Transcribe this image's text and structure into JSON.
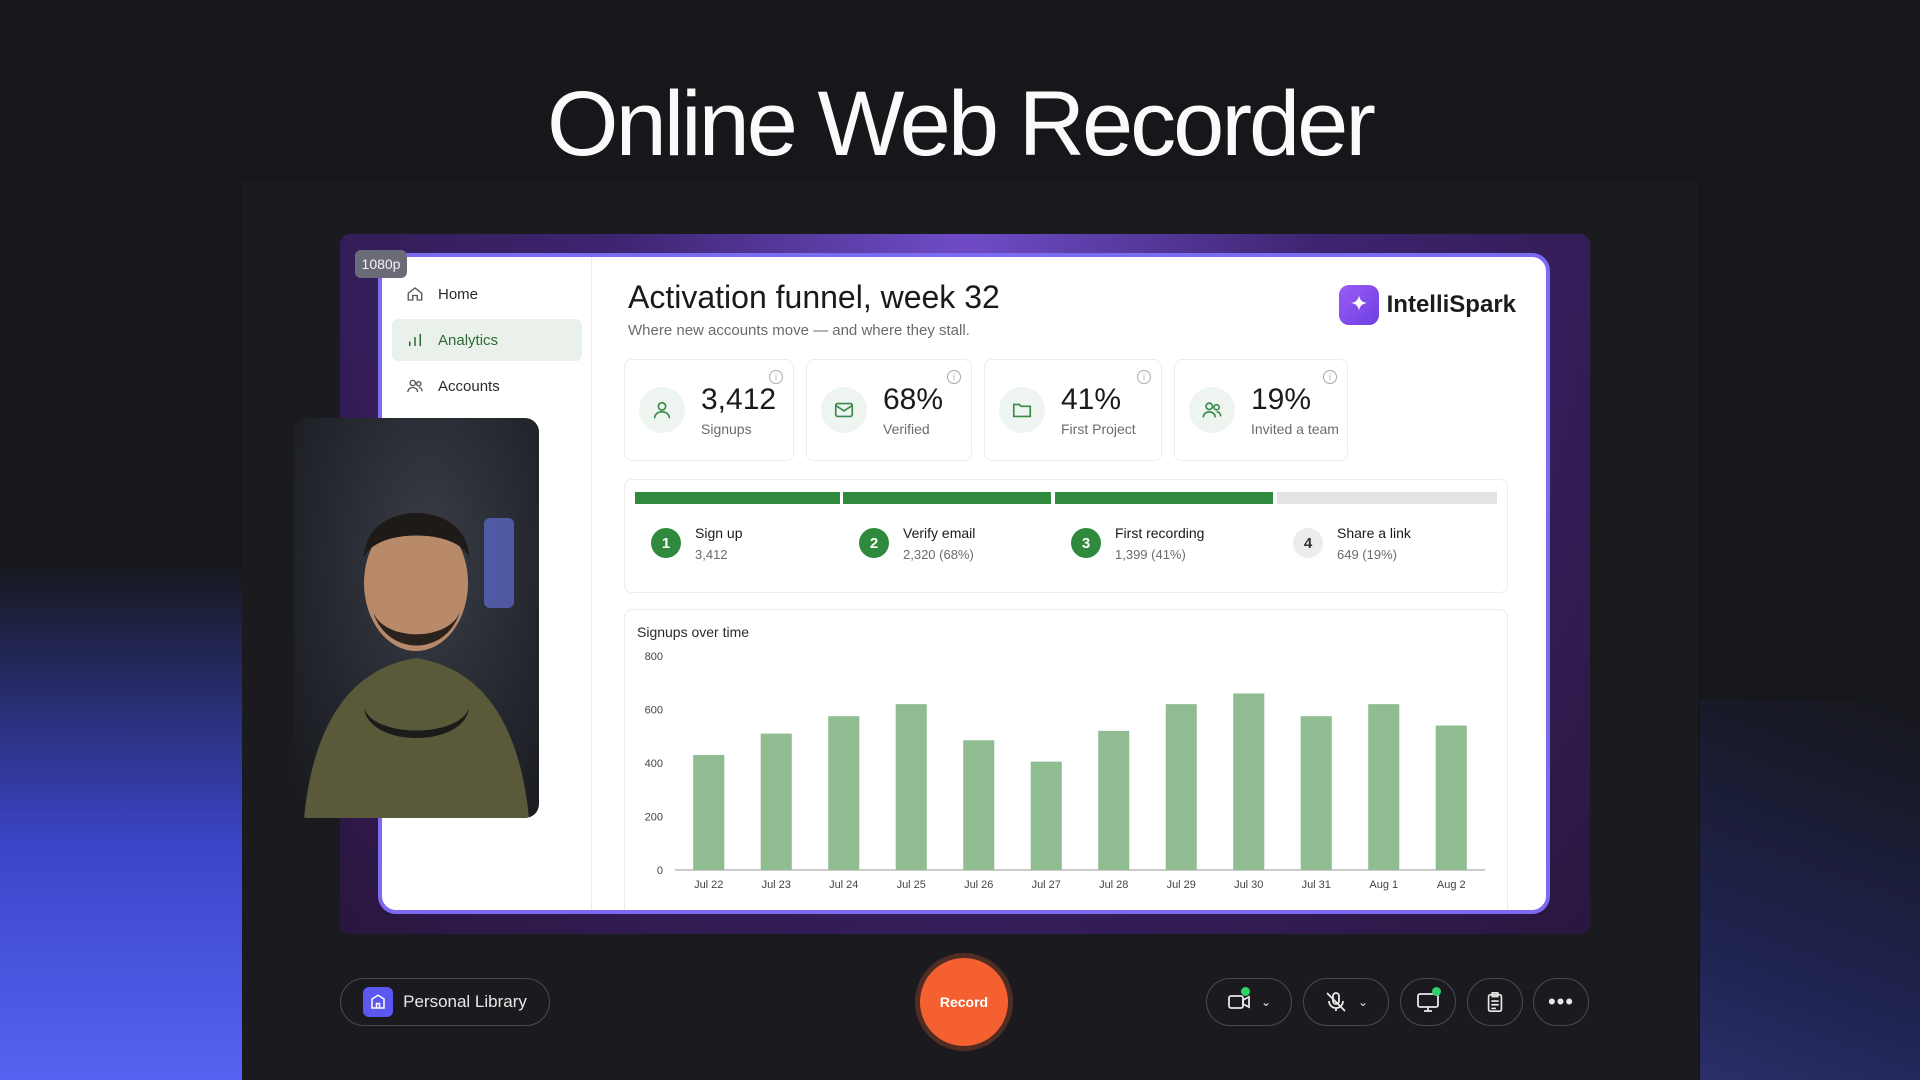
{
  "headline": "Online Web Recorder",
  "resolution_badge": "1080p",
  "sidebar": {
    "items": [
      {
        "label": "Home",
        "icon": "home-icon"
      },
      {
        "label": "Analytics",
        "icon": "bar-chart-icon",
        "active": true
      },
      {
        "label": "Accounts",
        "icon": "users-icon"
      }
    ]
  },
  "dashboard": {
    "title": "Activation funnel, week 32",
    "subtitle": "Where new accounts move — and where they stall.",
    "brand": "IntelliSpark",
    "stats": [
      {
        "value": "3,412",
        "label": "Signups",
        "icon": "user-icon"
      },
      {
        "value": "68%",
        "label": "Verified",
        "icon": "mail-icon"
      },
      {
        "value": "41%",
        "label": "First Project",
        "icon": "folder-icon"
      },
      {
        "value": "19%",
        "label": "Invited a team",
        "icon": "team-icon"
      }
    ],
    "funnel": [
      {
        "num": "1",
        "name": "Sign up",
        "count": "3,412",
        "completed": true
      },
      {
        "num": "2",
        "name": "Verify email",
        "count": "2,320 (68%)",
        "completed": true
      },
      {
        "num": "3",
        "name": "First recording",
        "count": "1,399 (41%)",
        "completed": true
      },
      {
        "num": "4",
        "name": "Share a link",
        "count": "649 (19%)",
        "completed": false
      }
    ],
    "chart_title": "Signups over time"
  },
  "chart_data": {
    "type": "bar",
    "title": "Signups over time",
    "categories": [
      "Jul 22",
      "Jul 23",
      "Jul 24",
      "Jul 25",
      "Jul 26",
      "Jul 27",
      "Jul 28",
      "Jul 29",
      "Jul 30",
      "Jul 31",
      "Aug 1",
      "Aug 2"
    ],
    "values": [
      430,
      510,
      575,
      620,
      485,
      405,
      520,
      620,
      660,
      575,
      620,
      540
    ],
    "yticks": [
      0,
      200,
      400,
      600,
      800
    ],
    "ylim": [
      0,
      800
    ],
    "grid": false,
    "bar_color": "#8fbc91"
  },
  "controls": {
    "library_label": "Personal Library",
    "record_label": "Record",
    "camera_icon": "camera-icon",
    "mic_icon": "mic-off-icon",
    "screen_icon": "screen-share-icon",
    "notes_icon": "clipboard-icon",
    "more_icon": "more-icon"
  },
  "colors": {
    "accent_green": "#2f8a3e",
    "record_orange": "#f4602f",
    "frame_purple": "#7a6bf0"
  }
}
